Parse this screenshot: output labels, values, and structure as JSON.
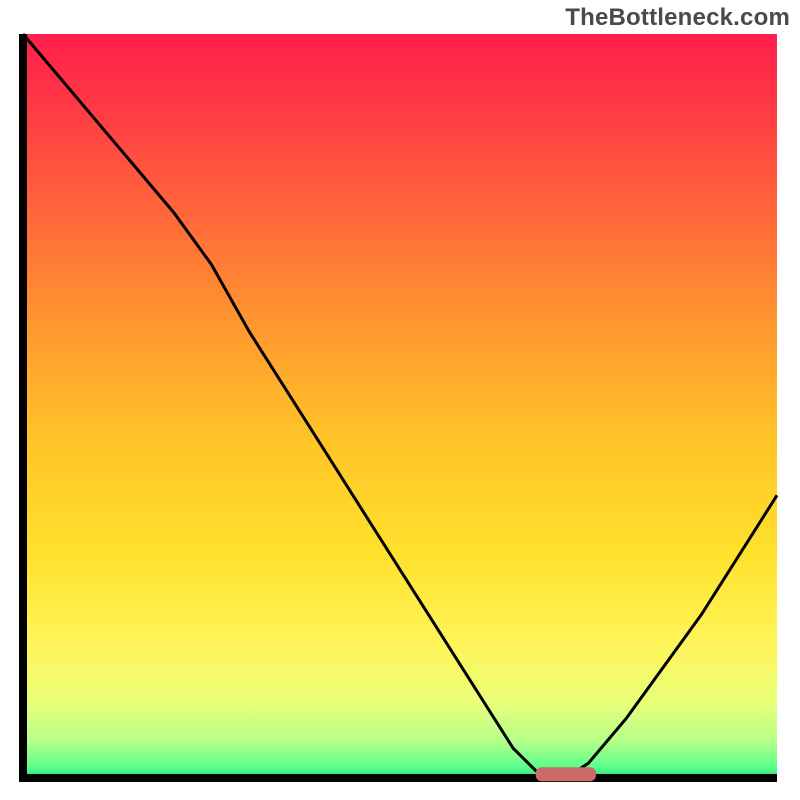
{
  "watermark": "TheBottleneck.com",
  "chart_data": {
    "type": "line",
    "title": "",
    "xlabel": "",
    "ylabel": "",
    "xlim": [
      0,
      100
    ],
    "ylim": [
      0,
      100
    ],
    "x": [
      0,
      5,
      10,
      15,
      20,
      25,
      30,
      35,
      40,
      45,
      50,
      55,
      60,
      65,
      68,
      70,
      72,
      75,
      80,
      85,
      90,
      95,
      100
    ],
    "values": [
      100,
      94,
      88,
      82,
      76,
      69,
      60,
      52,
      44,
      36,
      28,
      20,
      12,
      4,
      1,
      0,
      0,
      2,
      8,
      15,
      22,
      30,
      38
    ],
    "marker": {
      "x_start": 68,
      "x_end": 76,
      "y": 0.5,
      "color": "#cc6a6a"
    },
    "gradient_stops": [
      {
        "offset": 0.0,
        "color": "#ff1e4c"
      },
      {
        "offset": 0.1,
        "color": "#ff3a44"
      },
      {
        "offset": 0.25,
        "color": "#ff6a3a"
      },
      {
        "offset": 0.4,
        "color": "#ff9a2e"
      },
      {
        "offset": 0.55,
        "color": "#ffc528"
      },
      {
        "offset": 0.7,
        "color": "#ffe12c"
      },
      {
        "offset": 0.82,
        "color": "#fff55a"
      },
      {
        "offset": 0.9,
        "color": "#e8ff7a"
      },
      {
        "offset": 0.95,
        "color": "#b6ff8a"
      },
      {
        "offset": 0.985,
        "color": "#5cff8a"
      },
      {
        "offset": 1.0,
        "color": "#26e07a"
      }
    ],
    "axis_color": "#000000",
    "line_color": "#000000"
  }
}
